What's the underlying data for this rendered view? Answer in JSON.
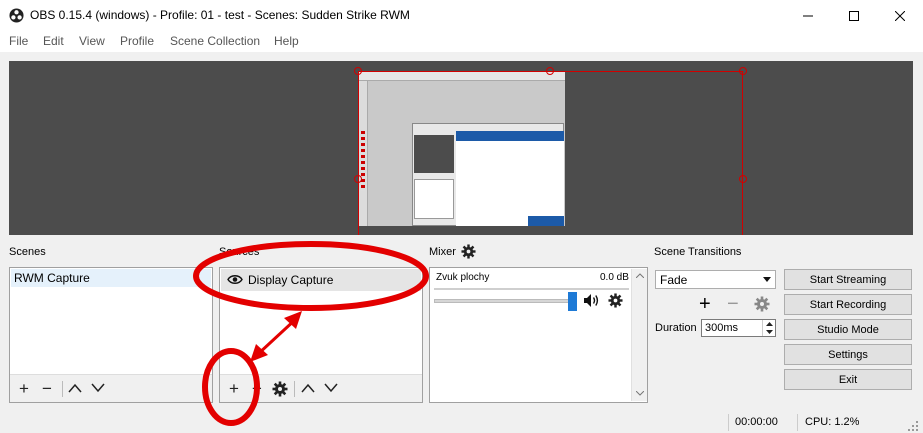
{
  "window": {
    "title": "OBS 0.15.4 (windows) - Profile: 01 - test - Scenes: Sudden Strike RWM"
  },
  "menu": [
    "File",
    "Edit",
    "View",
    "Profile",
    "Scene Collection",
    "Help"
  ],
  "scenes": {
    "title": "Scenes",
    "items": [
      "RWM Capture"
    ]
  },
  "sources": {
    "title": "Sources",
    "items": [
      {
        "label": "Display Capture",
        "icon": "eye-icon"
      }
    ]
  },
  "mixer": {
    "title": "Mixer",
    "channels": [
      {
        "name": "Zvuk plochy",
        "level": "0.0 dB",
        "volume_fraction": 0.95
      }
    ]
  },
  "transitions": {
    "title": "Scene Transitions",
    "selected": "Fade",
    "duration_label": "Duration",
    "duration_value": "300ms"
  },
  "controls": {
    "start_streaming": "Start Streaming",
    "start_recording": "Start Recording",
    "studio_mode": "Studio Mode",
    "settings": "Settings",
    "exit": "Exit"
  },
  "status": {
    "time": "00:00:00",
    "cpu": "CPU: 1.2%"
  },
  "colors": {
    "preview_bg": "#4c4c4c",
    "annotation": "#e30000",
    "volume_slider": "#1e7ad6",
    "selection_box": "#d10000"
  }
}
